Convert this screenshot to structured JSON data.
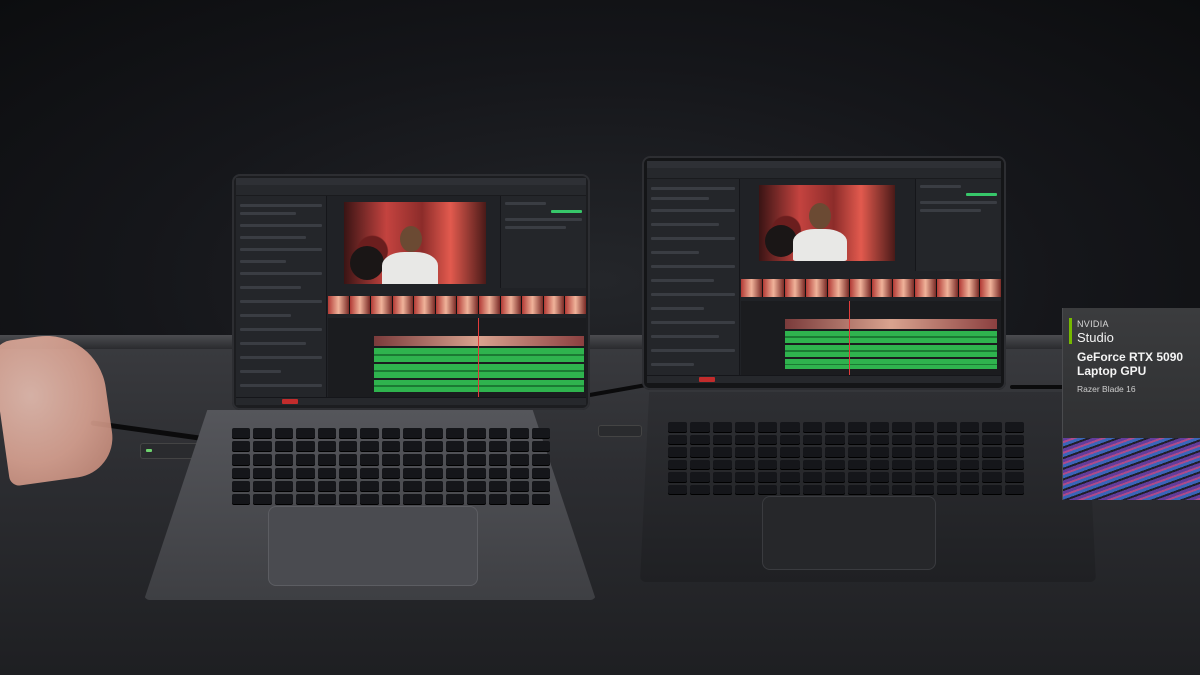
{
  "sign": {
    "brand": "NVIDIA",
    "sub_brand": "Studio",
    "product_line1": "GeForce RTX 5090",
    "product_line2": "Laptop GPU",
    "model": "Razer Blade 16"
  },
  "colors": {
    "nvidia_green": "#76b900",
    "timeline_audio": "#2fb34e",
    "render_red": "#c22c2c"
  },
  "icons": {
    "sign_accent": "nvidia-accent-bar-icon"
  }
}
